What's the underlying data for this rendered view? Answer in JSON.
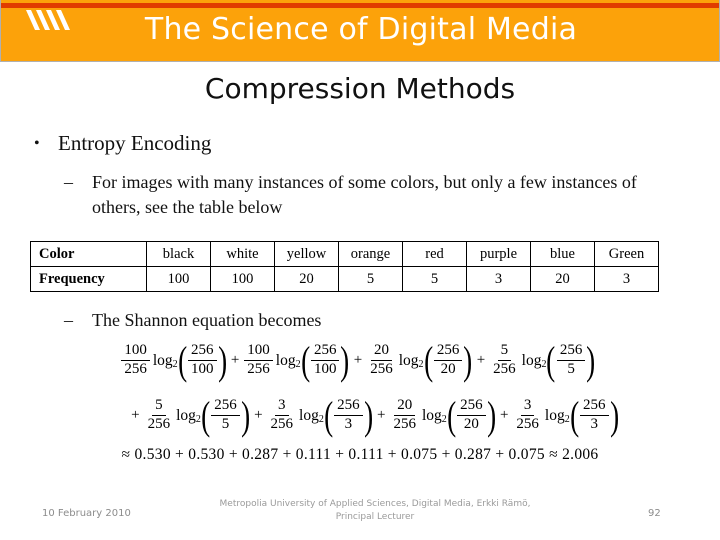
{
  "banner": {
    "title": "The Science of Digital Media",
    "logo_name": "metropolia-slashes-logo",
    "bg_color": "#FCA20A",
    "rule_color": "#E03C00",
    "title_color": "#FFFFFF"
  },
  "slide": {
    "title": "Compression Methods",
    "bullets": {
      "level1": "Entropy Encoding",
      "level1_marker": "•",
      "level2": "For images with many instances of some colors, but only a few instances of others, see the table below",
      "level2_marker": "–",
      "level3": "The Shannon equation becomes",
      "level3_marker": "–"
    }
  },
  "table": {
    "row_headers": [
      "Color",
      "Frequency"
    ],
    "colors": [
      "black",
      "white",
      "yellow",
      "orange",
      "red",
      "purple",
      "blue",
      "Green"
    ],
    "frequencies": [
      "100",
      "100",
      "20",
      "5",
      "5",
      "3",
      "20",
      "3"
    ]
  },
  "equation": {
    "line1": [
      {
        "num": "100",
        "den": "256",
        "log_num": "256",
        "log_den": "100"
      },
      {
        "num": "100",
        "den": "256",
        "log_num": "256",
        "log_den": "100"
      },
      {
        "num": "20",
        "den": "256",
        "log_num": "256",
        "log_den": "20"
      },
      {
        "num": "5",
        "den": "256",
        "log_num": "256",
        "log_den": "5"
      }
    ],
    "line2": [
      {
        "num": "5",
        "den": "256",
        "log_num": "256",
        "log_den": "5"
      },
      {
        "num": "3",
        "den": "256",
        "log_num": "256",
        "log_den": "3"
      },
      {
        "num": "20",
        "den": "256",
        "log_num": "256",
        "log_den": "20"
      },
      {
        "num": "3",
        "den": "256",
        "log_num": "256",
        "log_den": "3"
      }
    ],
    "log_label": "log",
    "log_base": "2",
    "plus": "+",
    "approx": "≈",
    "result": "≈ 0.530 + 0.530 + 0.287 + 0.111 + 0.111 + 0.075 + 0.287 + 0.075 ≈ 2.006",
    "result_terms": [
      "0.530",
      "0.530",
      "0.287",
      "0.111",
      "0.111",
      "0.075",
      "0.287",
      "0.075"
    ],
    "result_total": "2.006"
  },
  "footer": {
    "date": "10 February 2010",
    "attribution": "Metropolia University of Applied Sciences,  Digital Media, Erkki Rämö, Principal Lecturer",
    "page_number": "92"
  }
}
